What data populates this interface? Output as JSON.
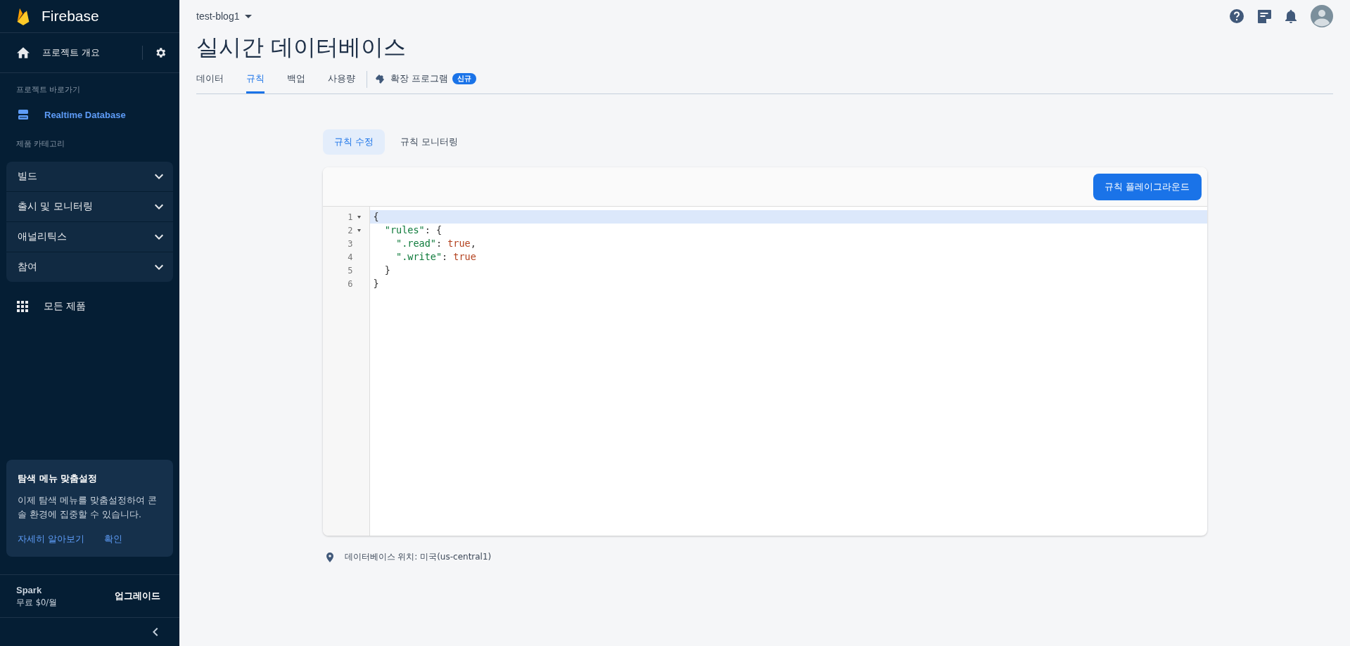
{
  "sidebar": {
    "brand": "Firebase",
    "overview": "프로젝트 개요",
    "shortcuts_heading": "프로젝트 바로가기",
    "shortcuts": [
      {
        "label": "Realtime Database",
        "selected": true
      }
    ],
    "categories_heading": "제품 카테고리",
    "groups": [
      {
        "label": "빌드",
        "expanded": false
      },
      {
        "label": "출시 및 모니터링",
        "expanded": false
      },
      {
        "label": "애널리틱스",
        "expanded": false
      },
      {
        "label": "참여",
        "expanded": false
      }
    ],
    "all_products": "모든 제품",
    "promo": {
      "title": "탐색 메뉴 맞춤설정",
      "body": "이제 탐색 메뉴를 맞춤설정하여 콘솔 환경에 집중할 수 있습니다.",
      "links": [
        "자세히 알아보기",
        "확인"
      ]
    },
    "plan": {
      "name": "Spark",
      "price": "무료 $0/월",
      "action": "업그레이드"
    }
  },
  "header": {
    "project": "test-blog1",
    "title": "실시간 데이터베이스"
  },
  "tabs": [
    {
      "label": "데이터",
      "selected": false
    },
    {
      "label": "규칙",
      "selected": true
    },
    {
      "label": "백업",
      "selected": false
    },
    {
      "label": "사용량",
      "selected": false
    },
    {
      "label": "확장 프로그램",
      "selected": false,
      "badge": "신규"
    }
  ],
  "subtabs": [
    {
      "label": "규칙 수정",
      "selected": true
    },
    {
      "label": "규칙 모니터링",
      "selected": false
    }
  ],
  "editor": {
    "button": "규칙 플레이그라운드",
    "lines": [
      {
        "number": "1",
        "foldable": true,
        "active": true,
        "tokens": [
          {
            "kind": "punct",
            "text": "{"
          }
        ]
      },
      {
        "number": "2",
        "foldable": true,
        "active": false,
        "tokens": [
          {
            "kind": "string",
            "text": "  \"rules\""
          },
          {
            "kind": "punct",
            "text": ": {"
          }
        ]
      },
      {
        "number": "3",
        "foldable": false,
        "active": false,
        "tokens": [
          {
            "kind": "string",
            "text": "    \".read\""
          },
          {
            "kind": "punct",
            "text": ": "
          },
          {
            "kind": "bool",
            "text": "true"
          },
          {
            "kind": "punct",
            "text": ","
          }
        ]
      },
      {
        "number": "4",
        "foldable": false,
        "active": false,
        "tokens": [
          {
            "kind": "string",
            "text": "    \".write\""
          },
          {
            "kind": "punct",
            "text": ": "
          },
          {
            "kind": "bool",
            "text": "true"
          }
        ]
      },
      {
        "number": "5",
        "foldable": false,
        "active": false,
        "tokens": [
          {
            "kind": "punct",
            "text": "  }"
          }
        ]
      },
      {
        "number": "6",
        "foldable": false,
        "active": false,
        "tokens": [
          {
            "kind": "punct",
            "text": "}"
          }
        ]
      }
    ]
  },
  "location": "데이터베이스 위치: 미국(us-central1)"
}
